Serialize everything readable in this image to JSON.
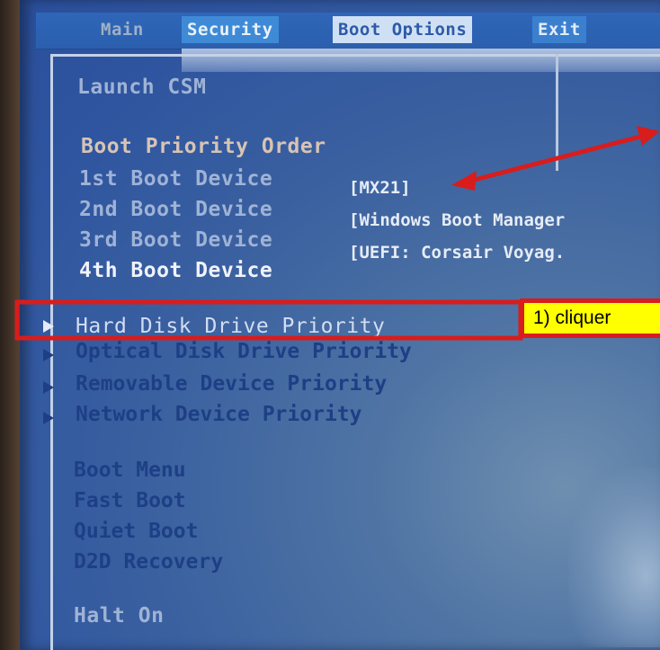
{
  "menu": {
    "tabs": [
      {
        "label": "Main"
      },
      {
        "label": "Security"
      },
      {
        "label": "Boot Options"
      },
      {
        "label": "Exit"
      }
    ]
  },
  "settings": {
    "launch_csm": "Launch CSM",
    "boot_priority_order": "Boot Priority Order",
    "boot_devices": [
      {
        "label": "1st Boot Device",
        "value": "[MX21]"
      },
      {
        "label": "2nd Boot Device",
        "value": "[Windows Boot Manager"
      },
      {
        "label": "3rd Boot Device",
        "value": "[UEFI: Corsair Voyag."
      },
      {
        "label": "4th Boot Device",
        "value": ""
      }
    ],
    "submenus": [
      {
        "label": "Hard Disk Drive Priority"
      },
      {
        "label": "Optical Disk Drive Priority"
      },
      {
        "label": "Removable Device Priority"
      },
      {
        "label": "Network Device Priority"
      }
    ],
    "boot_menu": "Boot Menu",
    "fast_boot": "Fast Boot",
    "quiet_boot": "Quiet Boot",
    "d2d_recovery": "D2D Recovery",
    "halt_on": "Halt On"
  },
  "annotation": {
    "callout": "1) cliquer",
    "color": "#d91c1c",
    "callout_bg": "#ffff00"
  },
  "colors": {
    "screen_blue": "#2f55a0",
    "menubar_blue": "#2b5fae",
    "selected_tab_bg": "#cfe0f4",
    "submenu_text": "#1e3f86"
  }
}
